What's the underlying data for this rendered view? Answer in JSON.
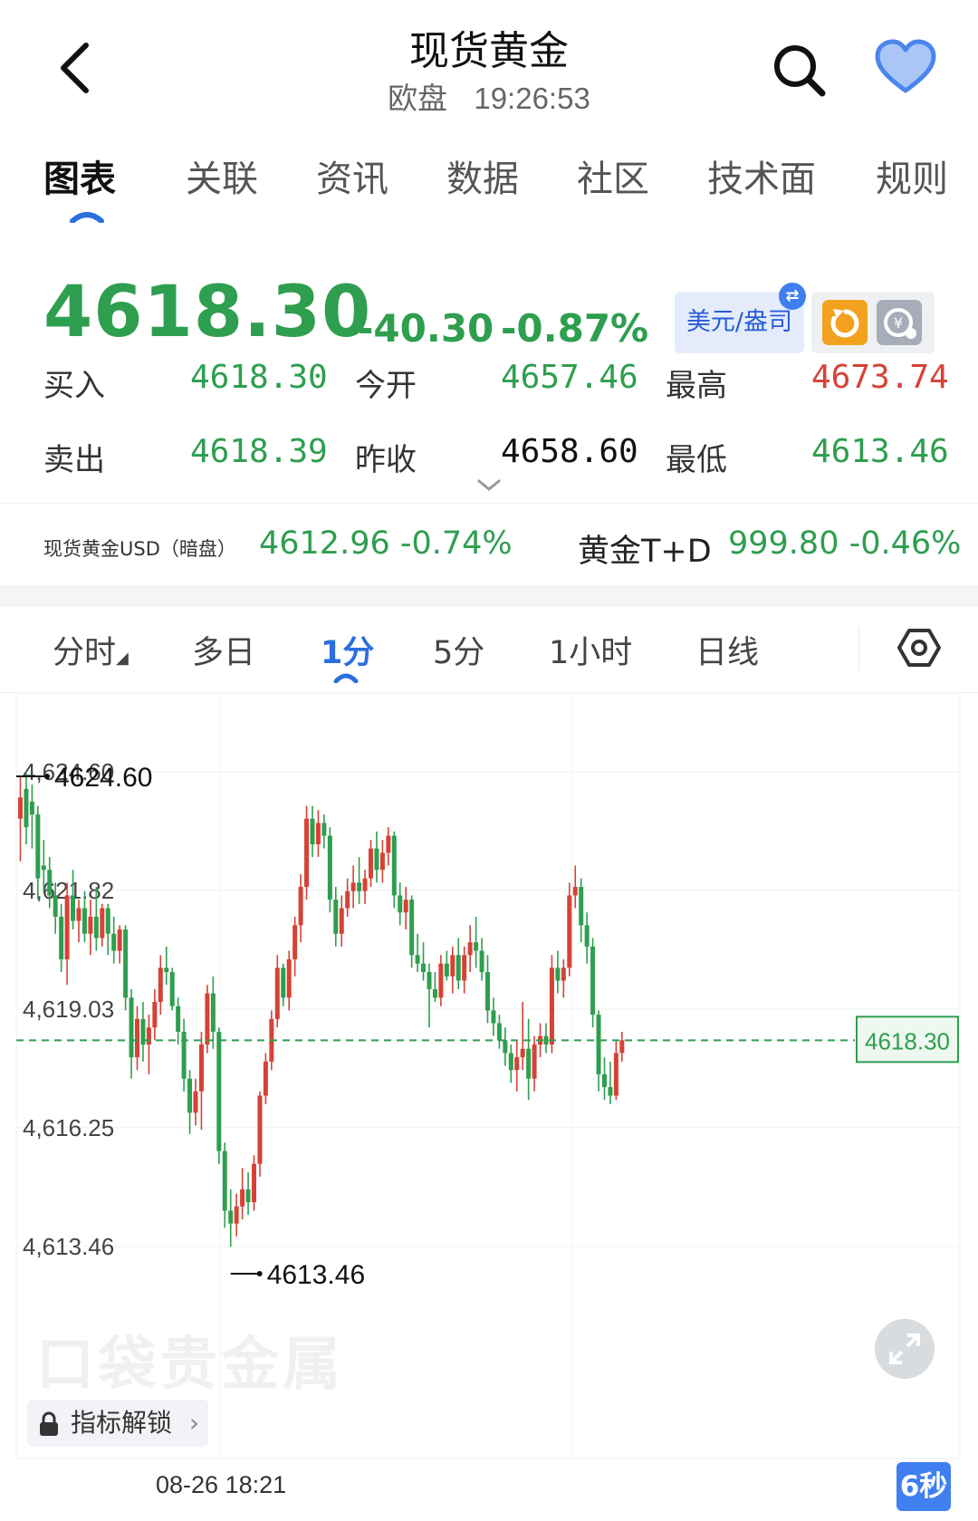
{
  "header": {
    "title": "现货黄金",
    "session": "欧盘",
    "clock": "19:26:53"
  },
  "tabs": [
    {
      "label": "图表",
      "active": true
    },
    {
      "label": "关联"
    },
    {
      "label": "资讯"
    },
    {
      "label": "数据"
    },
    {
      "label": "社区"
    },
    {
      "label": "技术面"
    },
    {
      "label": "规则"
    }
  ],
  "quote": {
    "price": "4618.30",
    "change": "-40.30",
    "change_pct": "-0.87%",
    "currency_label": "美元/盎司",
    "bid_label": "买入",
    "bid": "4618.30",
    "ask_label": "卖出",
    "ask": "4618.39",
    "open_label": "今开",
    "open": "4657.46",
    "prev_close_label": "昨收",
    "prev_close": "4658.60",
    "high_label": "最高",
    "high": "4673.74",
    "low_label": "最低",
    "low": "4613.46"
  },
  "related": {
    "item1_label": "现货黄金USD（暗盘）",
    "item1_value": "4612.96 -0.74%",
    "item2_label": "黄金T+D",
    "item2_value": "999.80 -0.46%"
  },
  "periods": [
    {
      "label": "分时"
    },
    {
      "label": "多日"
    },
    {
      "label": "1分",
      "active": true
    },
    {
      "label": "5分"
    },
    {
      "label": "1小时"
    },
    {
      "label": "日线"
    }
  ],
  "chart_data": {
    "type": "candlestick",
    "y_ticks": [
      "4,624.60",
      "4,621.82",
      "4,619.03",
      "4,616.25",
      "4,613.46"
    ],
    "ylim": [
      4613.46,
      4624.6
    ],
    "high_marker": "4624.60",
    "low_marker": "4613.46",
    "last_price": "4618.30",
    "x_tick": "08-26 18:21",
    "candles": [
      {
        "o": 4623.5,
        "h": 4624.5,
        "l": 4622.5,
        "c": 4624.0
      },
      {
        "o": 4624.2,
        "h": 4624.6,
        "l": 4622.9,
        "c": 4623.3
      },
      {
        "o": 4623.9,
        "h": 4624.3,
        "l": 4622.8,
        "c": 4623.6
      },
      {
        "o": 4623.6,
        "h": 4623.8,
        "l": 4621.6,
        "c": 4622.1
      },
      {
        "o": 4622.4,
        "h": 4623.0,
        "l": 4621.8,
        "c": 4622.3
      },
      {
        "o": 4622.3,
        "h": 4622.6,
        "l": 4621.4,
        "c": 4621.7
      },
      {
        "o": 4621.7,
        "h": 4622.0,
        "l": 4620.8,
        "c": 4621.2
      },
      {
        "o": 4621.2,
        "h": 4621.5,
        "l": 4619.9,
        "c": 4620.2
      },
      {
        "o": 4620.2,
        "h": 4622.0,
        "l": 4619.6,
        "c": 4621.7
      },
      {
        "o": 4621.7,
        "h": 4622.3,
        "l": 4620.9,
        "c": 4621.1
      },
      {
        "o": 4621.1,
        "h": 4621.6,
        "l": 4620.6,
        "c": 4621.4
      },
      {
        "o": 4621.4,
        "h": 4621.8,
        "l": 4620.6,
        "c": 4620.8
      },
      {
        "o": 4620.8,
        "h": 4621.6,
        "l": 4620.3,
        "c": 4621.2
      },
      {
        "o": 4621.2,
        "h": 4621.9,
        "l": 4620.4,
        "c": 4620.7
      },
      {
        "o": 4620.7,
        "h": 4621.5,
        "l": 4620.5,
        "c": 4621.4
      },
      {
        "o": 4621.4,
        "h": 4621.5,
        "l": 4620.3,
        "c": 4620.8
      },
      {
        "o": 4620.8,
        "h": 4621.2,
        "l": 4620.1,
        "c": 4620.4
      },
      {
        "o": 4620.4,
        "h": 4621.0,
        "l": 4620.1,
        "c": 4620.9
      },
      {
        "o": 4620.9,
        "h": 4621.0,
        "l": 4619.0,
        "c": 4619.3
      },
      {
        "o": 4619.3,
        "h": 4619.5,
        "l": 4617.4,
        "c": 4617.9
      },
      {
        "o": 4617.9,
        "h": 4619.1,
        "l": 4617.6,
        "c": 4618.8
      },
      {
        "o": 4618.8,
        "h": 4619.2,
        "l": 4617.8,
        "c": 4618.2
      },
      {
        "o": 4618.2,
        "h": 4618.9,
        "l": 4617.5,
        "c": 4618.6
      },
      {
        "o": 4618.6,
        "h": 4619.5,
        "l": 4618.3,
        "c": 4619.2
      },
      {
        "o": 4619.2,
        "h": 4620.3,
        "l": 4618.9,
        "c": 4620.0
      },
      {
        "o": 4620.0,
        "h": 4620.5,
        "l": 4619.6,
        "c": 4619.9
      },
      {
        "o": 4619.9,
        "h": 4620.0,
        "l": 4619.0,
        "c": 4619.1
      },
      {
        "o": 4619.1,
        "h": 4619.3,
        "l": 4618.2,
        "c": 4618.5
      },
      {
        "o": 4618.5,
        "h": 4618.8,
        "l": 4617.1,
        "c": 4617.4
      },
      {
        "o": 4617.4,
        "h": 4617.6,
        "l": 4616.1,
        "c": 4616.6
      },
      {
        "o": 4616.6,
        "h": 4617.4,
        "l": 4616.3,
        "c": 4617.1
      },
      {
        "o": 4617.1,
        "h": 4618.5,
        "l": 4616.2,
        "c": 4618.2
      },
      {
        "o": 4618.2,
        "h": 4619.6,
        "l": 4618.0,
        "c": 4619.4
      },
      {
        "o": 4619.4,
        "h": 4619.8,
        "l": 4618.1,
        "c": 4618.5
      },
      {
        "o": 4618.5,
        "h": 4618.6,
        "l": 4615.4,
        "c": 4615.7
      },
      {
        "o": 4615.7,
        "h": 4615.9,
        "l": 4613.9,
        "c": 4614.3
      },
      {
        "o": 4614.3,
        "h": 4614.8,
        "l": 4613.46,
        "c": 4614.0
      },
      {
        "o": 4614.0,
        "h": 4614.7,
        "l": 4613.7,
        "c": 4614.4
      },
      {
        "o": 4614.4,
        "h": 4615.3,
        "l": 4614.1,
        "c": 4614.8
      },
      {
        "o": 4614.8,
        "h": 4615.2,
        "l": 4614.2,
        "c": 4614.5
      },
      {
        "o": 4614.5,
        "h": 4615.6,
        "l": 4614.3,
        "c": 4615.4
      },
      {
        "o": 4615.4,
        "h": 4617.1,
        "l": 4615.1,
        "c": 4617.0
      },
      {
        "o": 4617.0,
        "h": 4618.0,
        "l": 4616.8,
        "c": 4617.8
      },
      {
        "o": 4617.8,
        "h": 4619.0,
        "l": 4617.6,
        "c": 4618.8
      },
      {
        "o": 4618.8,
        "h": 4620.3,
        "l": 4618.6,
        "c": 4620.0
      },
      {
        "o": 4620.0,
        "h": 4620.1,
        "l": 4619.1,
        "c": 4619.3
      },
      {
        "o": 4619.3,
        "h": 4620.4,
        "l": 4619.0,
        "c": 4620.2
      },
      {
        "o": 4620.2,
        "h": 4621.2,
        "l": 4619.8,
        "c": 4621.0
      },
      {
        "o": 4621.0,
        "h": 4622.2,
        "l": 4620.6,
        "c": 4621.9
      },
      {
        "o": 4621.9,
        "h": 4623.8,
        "l": 4621.6,
        "c": 4623.5
      },
      {
        "o": 4623.5,
        "h": 4623.8,
        "l": 4622.6,
        "c": 4622.9
      },
      {
        "o": 4622.9,
        "h": 4623.7,
        "l": 4622.6,
        "c": 4623.4
      },
      {
        "o": 4623.4,
        "h": 4623.6,
        "l": 4622.8,
        "c": 4623.1
      },
      {
        "o": 4623.1,
        "h": 4623.3,
        "l": 4621.3,
        "c": 4621.6
      },
      {
        "o": 4621.6,
        "h": 4621.9,
        "l": 4620.5,
        "c": 4620.8
      },
      {
        "o": 4620.8,
        "h": 4621.7,
        "l": 4620.5,
        "c": 4621.4
      },
      {
        "o": 4621.4,
        "h": 4622.1,
        "l": 4621.2,
        "c": 4621.8
      },
      {
        "o": 4621.8,
        "h": 4622.4,
        "l": 4621.4,
        "c": 4622.0
      },
      {
        "o": 4622.0,
        "h": 4622.6,
        "l": 4621.5,
        "c": 4621.8
      },
      {
        "o": 4621.8,
        "h": 4622.3,
        "l": 4621.5,
        "c": 4622.1
      },
      {
        "o": 4622.1,
        "h": 4623.0,
        "l": 4621.9,
        "c": 4622.8
      },
      {
        "o": 4622.8,
        "h": 4623.2,
        "l": 4622.0,
        "c": 4622.3
      },
      {
        "o": 4622.3,
        "h": 4623.0,
        "l": 4622.0,
        "c": 4622.7
      },
      {
        "o": 4622.7,
        "h": 4623.3,
        "l": 4622.4,
        "c": 4623.1
      },
      {
        "o": 4623.1,
        "h": 4623.2,
        "l": 4621.4,
        "c": 4621.7
      },
      {
        "o": 4621.7,
        "h": 4622.0,
        "l": 4621.0,
        "c": 4621.3
      },
      {
        "o": 4621.3,
        "h": 4621.9,
        "l": 4620.9,
        "c": 4621.6
      },
      {
        "o": 4621.6,
        "h": 4621.7,
        "l": 4620.0,
        "c": 4620.3
      },
      {
        "o": 4620.3,
        "h": 4620.8,
        "l": 4619.9,
        "c": 4620.1
      },
      {
        "o": 4620.1,
        "h": 4620.6,
        "l": 4619.7,
        "c": 4619.9
      },
      {
        "o": 4619.9,
        "h": 4620.1,
        "l": 4618.6,
        "c": 4619.5
      },
      {
        "o": 4619.5,
        "h": 4619.9,
        "l": 4619.2,
        "c": 4619.3
      },
      {
        "o": 4619.3,
        "h": 4620.3,
        "l": 4619.1,
        "c": 4620.1
      },
      {
        "o": 4620.1,
        "h": 4620.4,
        "l": 4619.7,
        "c": 4619.8
      },
      {
        "o": 4619.8,
        "h": 4620.5,
        "l": 4619.4,
        "c": 4620.3
      },
      {
        "o": 4620.3,
        "h": 4620.7,
        "l": 4619.5,
        "c": 4619.7
      },
      {
        "o": 4619.7,
        "h": 4620.5,
        "l": 4619.4,
        "c": 4620.3
      },
      {
        "o": 4620.3,
        "h": 4621.0,
        "l": 4619.9,
        "c": 4620.6
      },
      {
        "o": 4620.6,
        "h": 4621.2,
        "l": 4620.0,
        "c": 4620.4
      },
      {
        "o": 4620.4,
        "h": 4620.7,
        "l": 4619.7,
        "c": 4619.9
      },
      {
        "o": 4619.9,
        "h": 4620.3,
        "l": 4618.7,
        "c": 4619.0
      },
      {
        "o": 4619.0,
        "h": 4619.3,
        "l": 4618.4,
        "c": 4618.7
      },
      {
        "o": 4618.7,
        "h": 4618.9,
        "l": 4618.1,
        "c": 4618.3
      },
      {
        "o": 4618.3,
        "h": 4618.6,
        "l": 4617.7,
        "c": 4618.0
      },
      {
        "o": 4618.0,
        "h": 4618.2,
        "l": 4617.3,
        "c": 4617.6
      },
      {
        "o": 4617.6,
        "h": 4618.3,
        "l": 4617.1,
        "c": 4617.9
      },
      {
        "o": 4617.9,
        "h": 4619.2,
        "l": 4617.6,
        "c": 4618.1
      },
      {
        "o": 4618.1,
        "h": 4618.8,
        "l": 4616.9,
        "c": 4617.4
      },
      {
        "o": 4617.4,
        "h": 4618.4,
        "l": 4617.1,
        "c": 4618.2
      },
      {
        "o": 4618.2,
        "h": 4618.7,
        "l": 4617.9,
        "c": 4618.4
      },
      {
        "o": 4618.4,
        "h": 4618.7,
        "l": 4618.0,
        "c": 4618.2
      },
      {
        "o": 4618.2,
        "h": 4620.3,
        "l": 4618.0,
        "c": 4620.0
      },
      {
        "o": 4620.0,
        "h": 4620.4,
        "l": 4619.4,
        "c": 4619.7
      },
      {
        "o": 4619.7,
        "h": 4620.2,
        "l": 4619.3,
        "c": 4620.0
      },
      {
        "o": 4620.0,
        "h": 4622.0,
        "l": 4619.8,
        "c": 4621.7
      },
      {
        "o": 4621.7,
        "h": 4622.4,
        "l": 4621.4,
        "c": 4621.9
      },
      {
        "o": 4621.9,
        "h": 4622.1,
        "l": 4620.6,
        "c": 4621.0
      },
      {
        "o": 4621.0,
        "h": 4621.3,
        "l": 4620.1,
        "c": 4620.5
      },
      {
        "o": 4620.5,
        "h": 4620.7,
        "l": 4618.6,
        "c": 4618.9
      },
      {
        "o": 4618.9,
        "h": 4619.0,
        "l": 4617.1,
        "c": 4617.5
      },
      {
        "o": 4617.5,
        "h": 4617.9,
        "l": 4616.9,
        "c": 4617.2
      },
      {
        "o": 4617.2,
        "h": 4617.8,
        "l": 4616.8,
        "c": 4617.0
      },
      {
        "o": 4617.0,
        "h": 4618.3,
        "l": 4616.9,
        "c": 4618.0
      },
      {
        "o": 4618.0,
        "h": 4618.5,
        "l": 4617.8,
        "c": 4618.3
      }
    ]
  },
  "chart_ui": {
    "watermark": "口袋贵金属",
    "indicator_unlock": "指标解锁",
    "refresh_interval": "6秒"
  },
  "colors": {
    "up": "#d64236",
    "down": "#2e9e4f",
    "accent": "#2a6fe0"
  }
}
